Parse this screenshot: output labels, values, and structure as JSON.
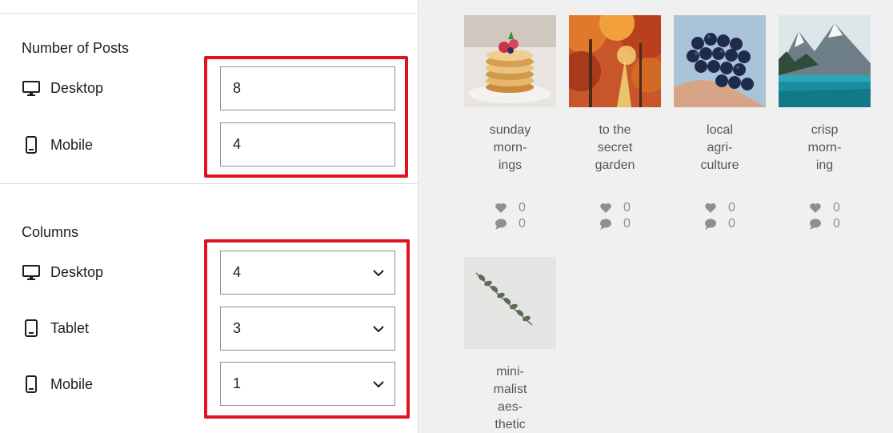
{
  "settings": {
    "posts": {
      "title": "Number of Posts",
      "desktop_label": "Desktop",
      "desktop_value": "8",
      "mobile_label": "Mobile",
      "mobile_value": "4"
    },
    "columns": {
      "title": "Columns",
      "desktop_label": "Desktop",
      "desktop_value": "4",
      "tablet_label": "Tablet",
      "tablet_value": "3",
      "mobile_label": "Mobile",
      "mobile_value": "1"
    }
  },
  "feed": {
    "posts": [
      {
        "title": "sunday\nmorn-\nings",
        "likes": "0",
        "comments": "0",
        "image": "pancakes"
      },
      {
        "title": "to the\nsecret\ngarden",
        "likes": "0",
        "comments": "0",
        "image": "autumn-forest"
      },
      {
        "title": "local\nagri-\nculture",
        "likes": "0",
        "comments": "0",
        "image": "grapes"
      },
      {
        "title": "crisp\nmorn-\ning",
        "likes": "0",
        "comments": "0",
        "image": "mountain-lake"
      },
      {
        "title": "mini-\nmalist\naes-\nthetic",
        "likes": "",
        "comments": "",
        "image": "eucalyptus"
      }
    ]
  },
  "colors": {
    "highlight": "#e0141e",
    "panel_bg": "#f0f0f1"
  }
}
